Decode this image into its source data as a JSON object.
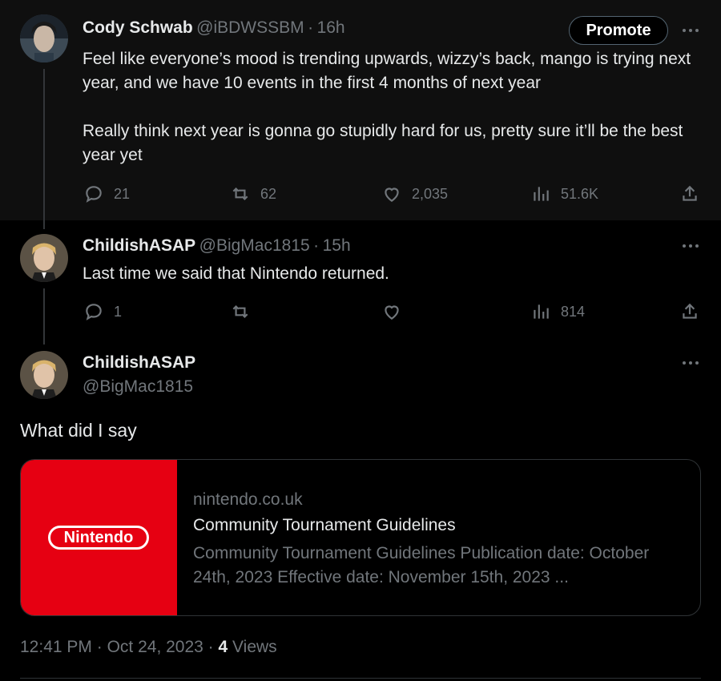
{
  "tweet1": {
    "name": "Cody Schwab",
    "handle": "@iBDWSSBM",
    "sep": "·",
    "time": "16h",
    "promote_label": "Promote",
    "text": "Feel like everyone’s mood is trending upwards, wizzy’s back, mango is trying next year, and we have 10 events in the first 4 months of next year\n\nReally think next year is gonna go stupidly hard for us, pretty sure it’ll be the best year yet",
    "replies": "21",
    "reposts": "62",
    "likes": "2,035",
    "views": "51.6K"
  },
  "tweet2": {
    "name": "ChildishASAP",
    "handle": "@BigMac1815",
    "sep": "·",
    "time": "15h",
    "text": "Last time we said that Nintendo returned.",
    "replies": "1",
    "reposts": "",
    "likes": "",
    "views": "814"
  },
  "tweet3": {
    "name": "ChildishASAP",
    "handle": "@BigMac1815",
    "text": "What did I say",
    "card": {
      "logo_text": "Nintendo",
      "domain": "nintendo.co.uk",
      "title": "Community Tournament Guidelines",
      "description": "Community Tournament Guidelines Publication date: October 24th, 2023 Effective date: November 15th, 2023 ..."
    },
    "footer": {
      "time": "12:41 PM",
      "sep1": "·",
      "date": "Oct 24, 2023",
      "sep2": "·",
      "views_count": "4",
      "views_label": "Views"
    }
  },
  "colors": {
    "background": "#000000",
    "text_primary": "#e7e9ea",
    "text_secondary": "#71767b",
    "nintendo_red": "#e60012"
  }
}
